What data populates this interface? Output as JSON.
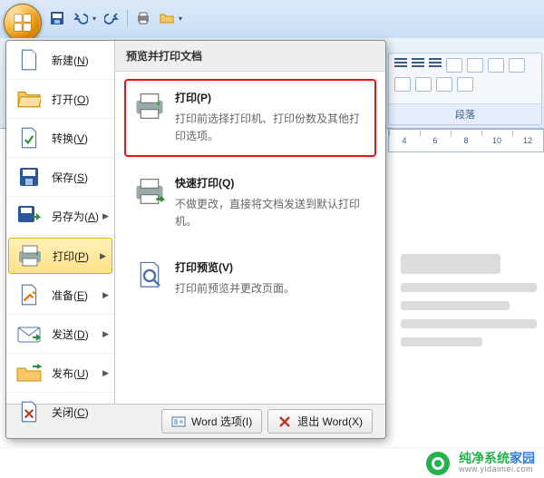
{
  "qat": {
    "save": "save",
    "undo": "undo",
    "redo": "redo",
    "print": "print",
    "open": "open",
    "dropdown": "▾"
  },
  "ribbon": {
    "group_label": "段落"
  },
  "ruler": {
    "ticks": [
      "4",
      "6",
      "8",
      "10",
      "12"
    ]
  },
  "file_menu": {
    "left_items": [
      {
        "id": "new",
        "label": "新建",
        "key": "N",
        "has_arrow": false
      },
      {
        "id": "open",
        "label": "打开",
        "key": "O",
        "has_arrow": false
      },
      {
        "id": "convert",
        "label": "转换",
        "key": "V",
        "has_arrow": false
      },
      {
        "id": "save",
        "label": "保存",
        "key": "S",
        "has_arrow": false
      },
      {
        "id": "saveas",
        "label": "另存为",
        "key": "A",
        "has_arrow": true
      },
      {
        "id": "print",
        "label": "打印",
        "key": "P",
        "has_arrow": true,
        "selected": true
      },
      {
        "id": "prepare",
        "label": "准备",
        "key": "E",
        "has_arrow": true
      },
      {
        "id": "send",
        "label": "发送",
        "key": "D",
        "has_arrow": true
      },
      {
        "id": "publish",
        "label": "发布",
        "key": "U",
        "has_arrow": true
      },
      {
        "id": "close",
        "label": "关闭",
        "key": "C",
        "has_arrow": false
      }
    ],
    "right_panel": {
      "header": "预览并打印文档",
      "options": [
        {
          "id": "print",
          "title": "打印",
          "key": "P",
          "desc": "打印前选择打印机、打印份数及其他打印选项。",
          "highlight": true
        },
        {
          "id": "quick",
          "title": "快速打印",
          "key": "Q",
          "desc": "不做更改，直接将文档发送到默认打印机。",
          "highlight": false
        },
        {
          "id": "preview",
          "title": "打印预览",
          "key": "V",
          "desc": "打印前预览并更改页面。",
          "highlight": false
        }
      ]
    },
    "footer": {
      "options_label": "Word 选项",
      "options_key": "I",
      "exit_label": "退出 Word",
      "exit_key": "X"
    }
  },
  "watermark": {
    "cn_a": "纯净系统",
    "cn_b": "家园",
    "en": "www.yidaimei.com"
  }
}
